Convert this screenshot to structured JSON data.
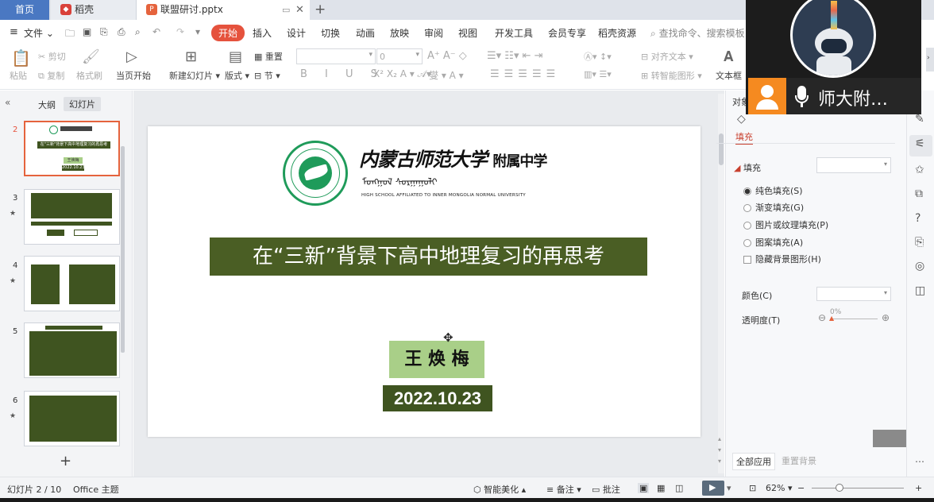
{
  "tabs": {
    "home": "首页",
    "docer": "稻壳",
    "document": "联盟研讨.pptx"
  },
  "menu": {
    "file": "文件",
    "start": "开始",
    "insert": "插入",
    "design": "设计",
    "transition": "切换",
    "animation": "动画",
    "slideshow": "放映",
    "review": "审阅",
    "view": "视图",
    "devtools": "开发工具",
    "member": "会员专享",
    "resources": "稻壳资源",
    "search_placeholder": "查找命令、搜索模板"
  },
  "ribbon": {
    "paste": "粘贴",
    "cut": "剪切",
    "copy": "复制",
    "format_painter": "格式刷",
    "from_current": "当页开始",
    "new_slide": "新建幻灯片",
    "layout": "版式",
    "section": "节",
    "reset": "重置",
    "font_size": "0",
    "text_align": "对齐文本",
    "smartart": "转智能图形",
    "textbox": "文本框"
  },
  "left_panel": {
    "outline_tab": "大纲",
    "slides_tab": "幻灯片",
    "slide_numbers": [
      "2",
      "3",
      "4",
      "5",
      "6"
    ],
    "thumb2_title": "在\"三新\"背景下高中地理复习的再思考",
    "thumb2_name": "王焕梅",
    "thumb2_date": "2022.10.23",
    "add_icon": "+"
  },
  "slide": {
    "school_name_cn": "内蒙古师范大学",
    "school_suffix": "附属中学",
    "school_name_en": "HIGH SCHOOL AFFILIATED TO INNER MONGOLIA NORMAL UNIVERSITY",
    "title": "在“三新”背景下高中地理复习的再思考",
    "author": "王 焕 梅",
    "date": "2022.10.23"
  },
  "right_panel": {
    "header": "对象",
    "fill_tab": "填充",
    "fill_section": "填充",
    "solid_fill": "纯色填充(S)",
    "gradient_fill": "渐变填充(G)",
    "picture_fill": "图片或纹理填充(P)",
    "pattern_fill": "图案填充(A)",
    "hide_bg": "隐藏背景图形(H)",
    "color_label": "颜色(C)",
    "transparency_label": "透明度(T)",
    "transparency_value": "0%",
    "apply_all": "全部应用",
    "reset_bg": "重置背景"
  },
  "video": {
    "participant": "师大附…"
  },
  "status": {
    "slide_counter": "幻灯片 2 / 10",
    "theme": "Office 主题",
    "smart_beautify": "智能美化",
    "notes": "备注",
    "comments": "批注",
    "zoom": "62%"
  },
  "colors": {
    "accent_red": "#e5523d",
    "slide_green": "#4a5e24",
    "author_green": "#a9cf88",
    "logo_green": "#1f9b5a",
    "home_tab_blue": "#4a78c2"
  }
}
